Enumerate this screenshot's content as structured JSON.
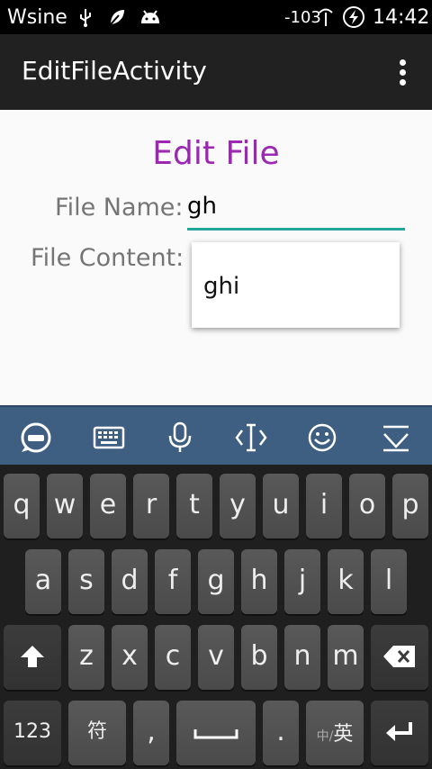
{
  "status": {
    "carrier": "Wsine",
    "signal": "-103",
    "time": "14:42"
  },
  "app": {
    "title": "EditFileActivity"
  },
  "form": {
    "heading": "Edit File",
    "name_label": "File Name:",
    "name_value": "gh",
    "content_label": "File Content:",
    "suggestion": "ghi"
  },
  "keyboard": {
    "row1": [
      "q",
      "w",
      "e",
      "r",
      "t",
      "y",
      "u",
      "i",
      "o",
      "p"
    ],
    "row2": [
      "a",
      "s",
      "d",
      "f",
      "g",
      "h",
      "j",
      "k",
      "l"
    ],
    "row3": [
      "z",
      "x",
      "c",
      "v",
      "b",
      "n",
      "m"
    ],
    "num_label": "123",
    "sym_label": "符",
    "comma_label": ",",
    "period_label": ".",
    "lang_label_small": "中/",
    "lang_label": "英"
  },
  "colors": {
    "accent": "#9c27b0",
    "underline": "#26a69a",
    "ime_bar": "#3f5f82"
  }
}
